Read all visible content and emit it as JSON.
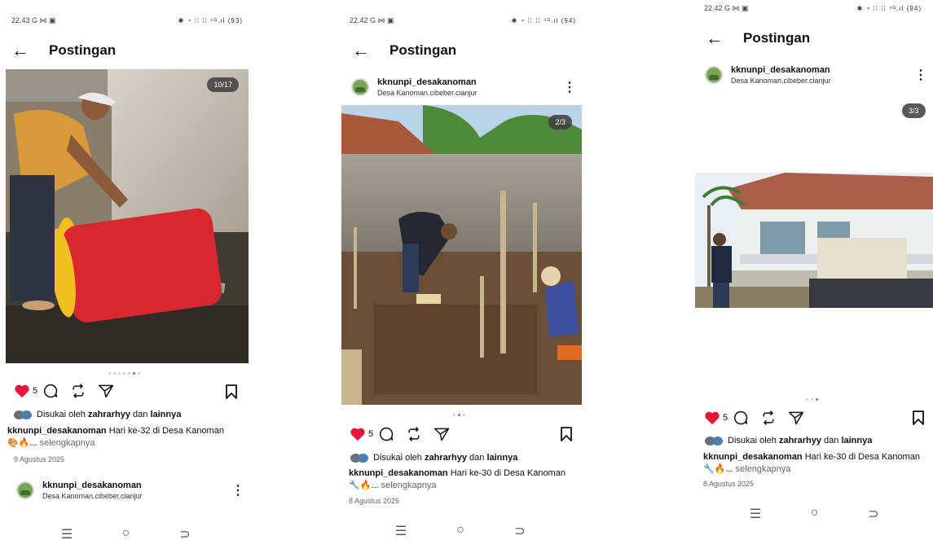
{
  "screens": [
    {
      "status_time": "22.43",
      "status_left_icons": "G ⋈ ▣",
      "status_right_icons": "✱ ◔ ⁞⁞ ⁞⁞ ⁴ᴳ.ıl (93)",
      "header_title": "Postingan",
      "counter": "10/17",
      "likes": "5",
      "liked_text": "Disukai oleh",
      "liked_user": "zahrarhyy",
      "liked_and": "dan",
      "liked_others": "lainnya",
      "caption_user": "kknunpi_desakanoman",
      "caption_text": "Hari ke-32 di Desa Kanoman",
      "caption_emoji": "🎨🔥...",
      "see_more": "selengkapnya",
      "date": "9 Agustus 2025",
      "next_user": "kknunpi_desakanoman",
      "next_location": "Desa Kanoman.cibeber.cianjur",
      "nav": [
        "☰",
        "○",
        "⊃"
      ]
    },
    {
      "status_time": "22.42",
      "status_left_icons": "G ⋈ ▣",
      "status_right_icons": "✱ ◔ ⁞⁞ ⁞⁞ ⁴ᴳ.ıl (94)",
      "header_title": "Postingan",
      "username": "kknunpi_desakanoman",
      "location": "Desa Kanoman.cibeber.cianjur",
      "counter": "2/3",
      "likes": "5",
      "liked_text": "Disukai oleh",
      "liked_user": "zahrarhyy",
      "liked_and": "dan",
      "liked_others": "lainnya",
      "caption_user": "kknunpi_desakanoman",
      "caption_text": "Hari ke-30 di Desa Kanoman",
      "caption_emoji": "🔧🔥...",
      "see_more": "selengkapnya",
      "date": "8 Agustus 2025",
      "nav": [
        "☰",
        "○",
        "⊃"
      ]
    },
    {
      "status_time": "22.42",
      "status_left_icons": "G ⋈ ▣",
      "status_right_icons": "✱ ◔ ⁞⁞ ⁞⁞ ⁴ᴳ.ıl (94)",
      "header_title": "Postingan",
      "username": "kknunpi_desakanoman",
      "location": "Desa Kanoman.cibeber.cianjur",
      "counter": "3/3",
      "likes": "5",
      "liked_text": "Disukai oleh",
      "liked_user": "zahrarhyy",
      "liked_and": "dan",
      "liked_others": "lainnya",
      "caption_user": "kknunpi_desakanoman",
      "caption_text": "Hari ke-30 di Desa Kanoman",
      "caption_emoji": "🔧🔥...",
      "see_more": "selengkapnya",
      "date": "8 Agustus 2025",
      "nav": [
        "☰",
        "○",
        "⊃"
      ]
    }
  ],
  "colors": {
    "heart": "#e8143b",
    "dot_active": "#3a8dde",
    "counter_bg": "#3c3c3c"
  },
  "icons": [
    "back-arrow-icon",
    "heart-icon",
    "comment-icon",
    "repost-icon",
    "share-icon",
    "bookmark-icon",
    "more-icon"
  ]
}
